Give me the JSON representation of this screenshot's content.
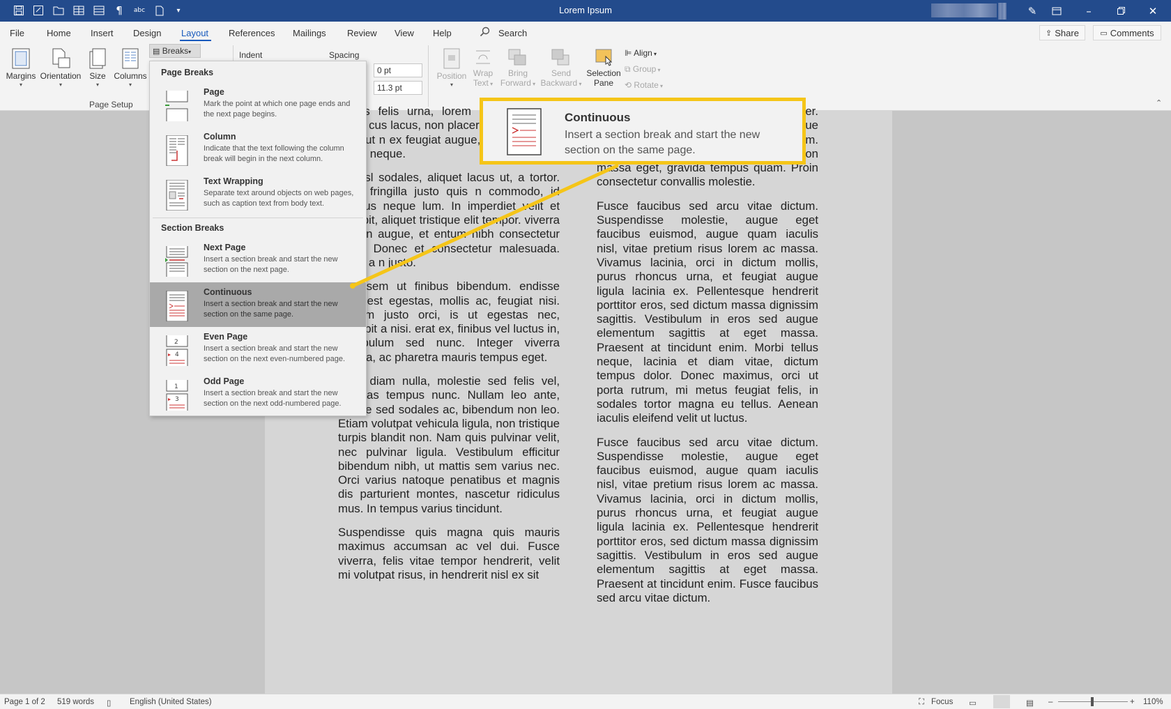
{
  "titlebar": {
    "title": "Lorem Ipsum",
    "quick_access_icons": [
      "save-icon",
      "autosave-icon",
      "open-folder-icon",
      "table-icon",
      "layout-icon",
      "pilcrow-icon",
      "spelling-icon",
      "new-document-icon",
      "customize-arrow-icon"
    ]
  },
  "tabs": [
    {
      "label": "File"
    },
    {
      "label": "Home"
    },
    {
      "label": "Insert"
    },
    {
      "label": "Design"
    },
    {
      "label": "Layout"
    },
    {
      "label": "References"
    },
    {
      "label": "Mailings"
    },
    {
      "label": "Review"
    },
    {
      "label": "View"
    },
    {
      "label": "Help"
    }
  ],
  "active_tab": "Layout",
  "search_label": "Search",
  "share_label": "Share",
  "comments_label": "Comments",
  "ribbon": {
    "margins": "Margins",
    "orientation": "Orientation",
    "size": "Size",
    "columns": "Columns",
    "breaks": "Breaks",
    "page_setup_group": "Page Setup",
    "indent": "Indent",
    "spacing": "Spacing",
    "spacing_before": "0 pt",
    "spacing_after": "11.3 pt",
    "position": "Position",
    "wrap": "Wrap",
    "text": "Text",
    "bring": "Bring",
    "forward": "Forward",
    "send": "Send",
    "backward": "Backward",
    "selection": "Selection",
    "pane": "Pane",
    "align": "Align",
    "group": "Group",
    "rotate": "Rotate"
  },
  "breaks_menu": {
    "page_breaks_header": "Page Breaks",
    "section_breaks_header": "Section Breaks",
    "items": [
      {
        "title": "Page",
        "desc": "Mark the point at which one page ends and the next page begins."
      },
      {
        "title": "Column",
        "desc": "Indicate that the text following the column break will begin in the next column."
      },
      {
        "title": "Text Wrapping",
        "desc": "Separate text around objects on web pages, such as caption text from body text."
      },
      {
        "title": "Next Page",
        "desc": "Insert a section break and start the new section on the next page."
      },
      {
        "title": "Continuous",
        "desc": "Insert a section break and start the new section on the same page."
      },
      {
        "title": "Even Page",
        "desc": "Insert a section break and start the new section on the next even-numbered page."
      },
      {
        "title": "Odd Page",
        "desc": "Insert a section break and start the new section on the next odd-numbered page."
      }
    ],
    "selected": "Continuous"
  },
  "callout": {
    "title": "Continuous",
    "desc": "Insert a section break and start the new section on the same page.",
    "border_color": "#f5c518"
  },
  "document": {
    "left_column": [
      "aenas felis urna, lorem aliquet lobortis tortor cus lacus, non placerat Nulla ornare, urna ut n ex feugiat augue, quis porttitor e dui at neque.",
      "ac nisl sodales, aliquet lacus ut, a tortor. Nam fringilla justo quis n commodo, id tempus neque lum. In imperdiet velit et velit pit, aliquet tristique elit tempor. viverra sapien augue, et entum nibh consectetur vitae. Donec et consectetur malesuada. Proin a n justo.",
      "orta sem ut finibus bibendum. endisse eget est egestas, mollis ac, feugiat nisi. Nullam justo orci, is ut egestas nec, suscipit a nisi. erat ex, finibus vel luctus in, vestibulum sed nunc. Integer viverra massa, ac pharetra mauris tempus eget.",
      "Cras diam nulla, molestie sed felis vel, egestas tempus nunc. Nullam leo ante, ornare sed sodales ac, bibendum non leo. Etiam volutpat vehicula ligula, non tristique turpis blandit non. Nam quis pulvinar velit, nec pulvinar ligula. Vestibulum efficitur bibendum nibh, ut mattis sem varius nec. Orci varius natoque penatibus et magnis dis parturient montes, nascetur ridiculus mus. In tempus varius tincidunt.",
      "Suspendisse quis magna quis mauris maximus accumsan ac vel dui. Fusce viverra, felis vitae tempor hendrerit, velit mi volutpat risus, in hendrerit nisl ex sit"
    ],
    "right_column": [
      "ec get sem vitae tortor rutrum semper. Nulla volutpat tempor nibh, at scelerisque diam lacinia et. Nunc at eros diam. Pellentesque odio massa, volutpat non massa eget, gravida tempus quam. Proin consectetur convallis molestie.",
      "Fusce faucibus sed arcu vitae dictum. Suspendisse molestie, augue eget faucibus euismod, augue quam iaculis nisl, vitae pretium risus lorem ac massa. Vivamus lacinia, orci in dictum mollis, purus rhoncus urna, et feugiat augue ligula lacinia ex. Pellentesque hendrerit porttitor eros, sed dictum massa dignissim sagittis. Vestibulum in eros sed augue elementum sagittis at eget massa. Praesent at tincidunt enim. Morbi tellus neque, lacinia et diam vitae, dictum tempus dolor. Donec maximus, orci ut porta rutrum, mi metus feugiat felis, in sodales tortor magna eu tellus. Aenean iaculis eleifend velit ut luctus.",
      "Fusce faucibus sed arcu vitae dictum. Suspendisse molestie, augue eget faucibus euismod, augue quam iaculis nisl, vitae pretium risus lorem ac massa. Vivamus lacinia, orci in dictum mollis, purus rhoncus urna, et feugiat augue ligula lacinia ex. Pellentesque hendrerit porttitor eros, sed dictum massa dignissim sagittis. Vestibulum in eros sed augue elementum sagittis at eget massa. Praesent at tincidunt enim. Fusce faucibus sed arcu vitae dictum."
    ]
  },
  "statusbar": {
    "page": "Page 1 of 2",
    "words": "519 words",
    "language": "English (United States)",
    "focus": "Focus",
    "zoom": "110%"
  }
}
